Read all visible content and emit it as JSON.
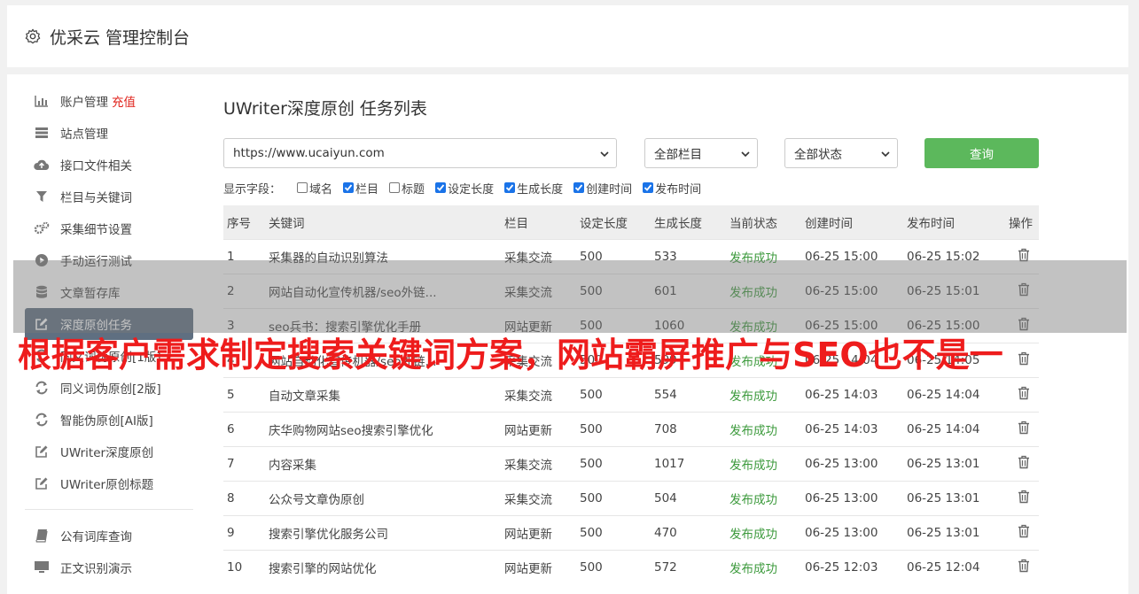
{
  "header": {
    "title": "优采云 管理控制台",
    "icon": "gear-icon"
  },
  "sidebar": {
    "items": [
      {
        "label": "账户管理",
        "extra": "充值",
        "icon": "bar-chart-icon"
      },
      {
        "label": "站点管理",
        "icon": "server-icon"
      },
      {
        "label": "接口文件相关",
        "icon": "cloud-upload-icon"
      },
      {
        "label": "栏目与关键词",
        "icon": "filter-icon"
      },
      {
        "label": "采集细节设置",
        "icon": "cogs-icon"
      },
      {
        "label": "手动运行测试",
        "icon": "play-icon"
      },
      {
        "label": "文章暂存库",
        "icon": "database-icon"
      },
      {
        "label": "深度原创任务",
        "icon": "edit-icon",
        "active": true
      },
      {
        "label": "同义词伪原创[1版]",
        "icon": "refresh-icon"
      },
      {
        "label": "同义词伪原创[2版]",
        "icon": "refresh-icon"
      },
      {
        "label": "智能伪原创[AI版]",
        "icon": "refresh-icon"
      },
      {
        "label": "UWriter深度原创",
        "icon": "edit-icon"
      },
      {
        "label": "UWriter原创标题",
        "icon": "edit-icon"
      }
    ],
    "items2": [
      {
        "label": "公有词库查询",
        "icon": "book-icon"
      },
      {
        "label": "正文识别演示",
        "icon": "monitor-icon"
      }
    ]
  },
  "main": {
    "title": "UWriter深度原创 任务列表",
    "site_select": "https://www.ucaiyun.com",
    "column_select": "全部栏目",
    "status_select": "全部状态",
    "query_label": "查询",
    "fields_label": "显示字段：",
    "fields": [
      {
        "label": "域名",
        "checked": false
      },
      {
        "label": "栏目",
        "checked": true
      },
      {
        "label": "标题",
        "checked": false
      },
      {
        "label": "设定长度",
        "checked": true
      },
      {
        "label": "生成长度",
        "checked": true
      },
      {
        "label": "创建时间",
        "checked": true
      },
      {
        "label": "发布时间",
        "checked": true
      }
    ]
  },
  "table": {
    "headers": [
      "序号",
      "关键词",
      "栏目",
      "设定长度",
      "生成长度",
      "当前状态",
      "创建时间",
      "发布时间",
      "操作"
    ],
    "rows": [
      [
        "1",
        "采集器的自动识别算法",
        "采集交流",
        "500",
        "533",
        "发布成功",
        "06-25 15:00",
        "06-25 15:02"
      ],
      [
        "2",
        "网站自动化宣传机器/seo外链...",
        "采集交流",
        "500",
        "601",
        "发布成功",
        "06-25 15:00",
        "06-25 15:01"
      ],
      [
        "3",
        "seo兵书：搜索引擎优化手册",
        "网站更新",
        "500",
        "1060",
        "发布成功",
        "06-25 15:00",
        "06-25 15:00"
      ],
      [
        "4",
        "网站自动化宣传机器/seo外链...",
        "采集交流",
        "500",
        "599",
        "发布成功",
        "06-25 14:04",
        "06-25 14:05"
      ],
      [
        "5",
        "自动文章采集",
        "采集交流",
        "500",
        "554",
        "发布成功",
        "06-25 14:03",
        "06-25 14:04"
      ],
      [
        "6",
        "庆华购物网站seo搜索引擎优化",
        "网站更新",
        "500",
        "708",
        "发布成功",
        "06-25 14:03",
        "06-25 14:04"
      ],
      [
        "7",
        "内容采集",
        "采集交流",
        "500",
        "1017",
        "发布成功",
        "06-25 13:00",
        "06-25 13:01"
      ],
      [
        "8",
        "公众号文章伪原创",
        "采集交流",
        "500",
        "504",
        "发布成功",
        "06-25 13:00",
        "06-25 13:01"
      ],
      [
        "9",
        "搜索引擎优化服务公司",
        "网站更新",
        "500",
        "470",
        "发布成功",
        "06-25 13:00",
        "06-25 13:01"
      ],
      [
        "10",
        "搜索引擎的网站优化",
        "网站更新",
        "500",
        "572",
        "发布成功",
        "06-25 12:03",
        "06-25 12:04"
      ]
    ]
  },
  "overlay_banner": "根据客户需求制定搜索关键词方案，网站霸屏推广与SEO也不是一"
}
